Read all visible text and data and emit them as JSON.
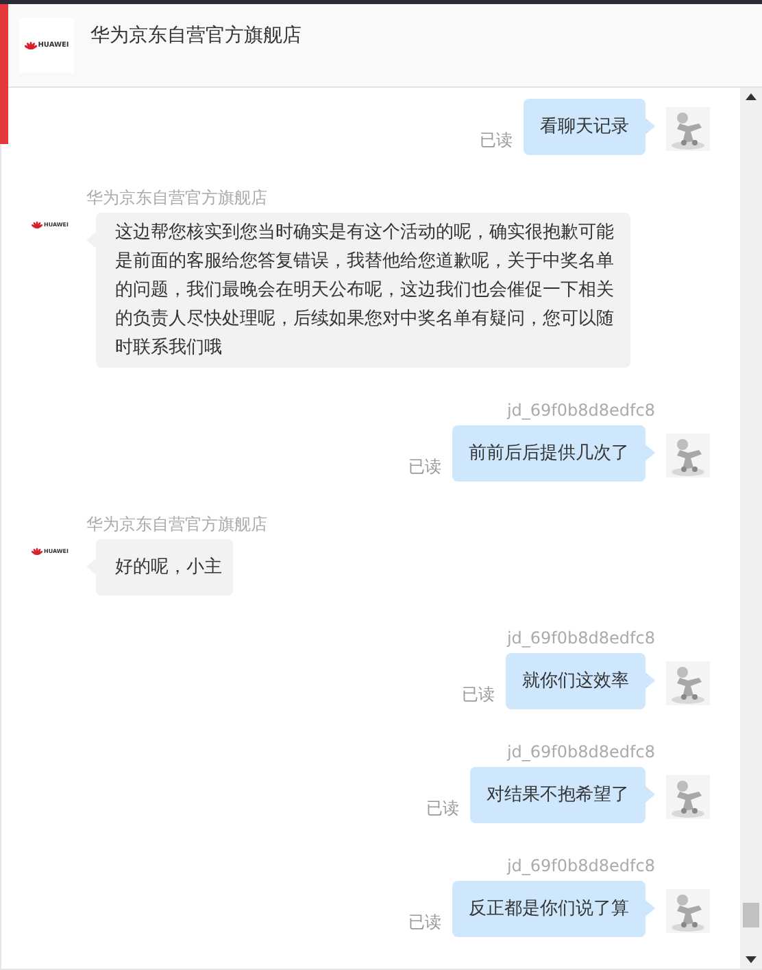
{
  "header": {
    "title": "华为京东自营官方旗舰店",
    "logo_text": "HUAWEI"
  },
  "messages": [
    {
      "kind": "user",
      "text": "看聊天记录",
      "status": "已读"
    },
    {
      "kind": "shop",
      "name": "华为京东自营官方旗舰店",
      "logo_text": "HUAWEI",
      "text": "这边帮您核实到您当时确实是有这个活动的呢，确实很抱歉可能是前面的客服给您答复错误，我替他给您道歉呢，关于中奖名单的问题，我们最晚会在明天公布呢，这边我们也会催促一下相关的负责人尽快处理呢，后续如果您对中奖名单有疑问，您可以随时联系我们哦"
    },
    {
      "kind": "user",
      "name": "jd_69f0b8d8edfc8",
      "text": "前前后后提供几次了",
      "status": "已读"
    },
    {
      "kind": "shop",
      "name": "华为京东自营官方旗舰店",
      "logo_text": "HUAWEI",
      "text": "好的呢，小主"
    },
    {
      "kind": "user",
      "name": "jd_69f0b8d8edfc8",
      "text": "就你们这效率",
      "status": "已读"
    },
    {
      "kind": "user",
      "name": "jd_69f0b8d8edfc8",
      "text": "对结果不抱希望了",
      "status": "已读"
    },
    {
      "kind": "user",
      "name": "jd_69f0b8d8edfc8",
      "text": "反正都是你们说了算",
      "status": "已读"
    }
  ]
}
